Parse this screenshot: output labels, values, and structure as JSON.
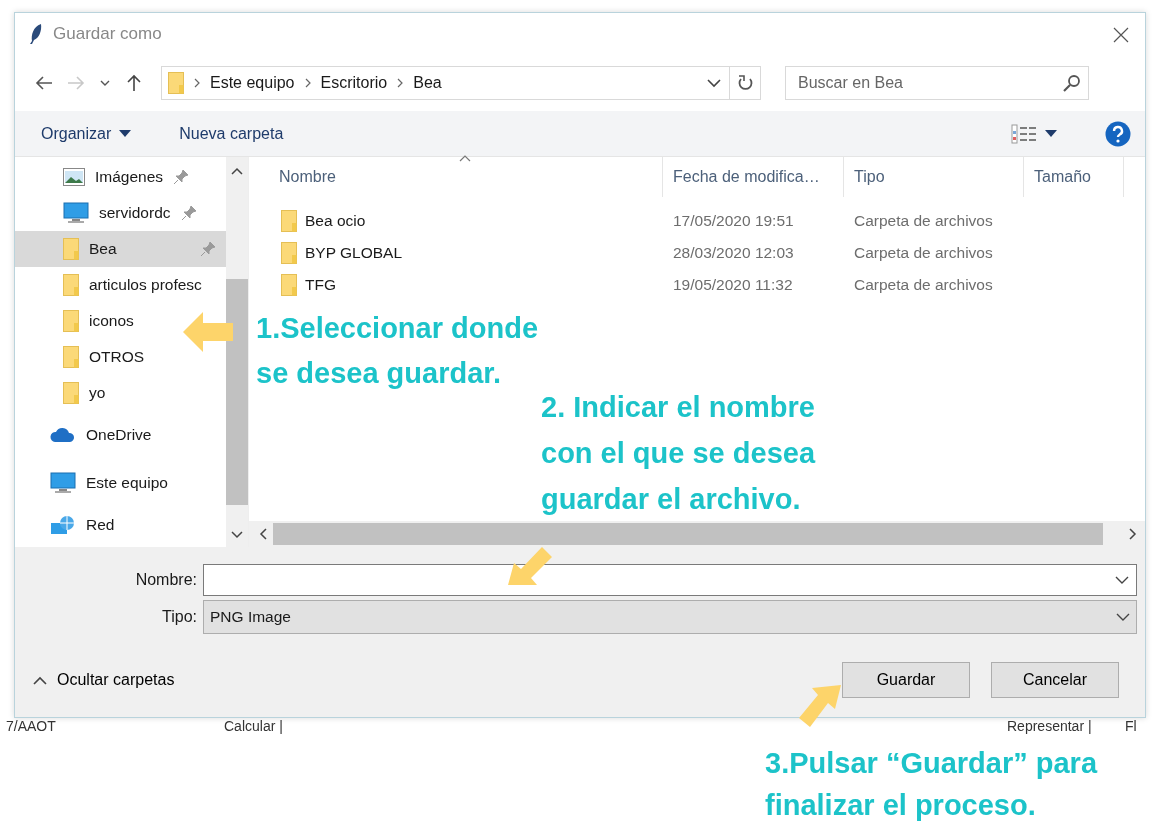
{
  "window": {
    "title": "Guardar como"
  },
  "address": {
    "path": [
      "Este equipo",
      "Escritorio",
      "Bea"
    ]
  },
  "search": {
    "placeholder": "Buscar en Bea"
  },
  "toolbar": {
    "organize": "Organizar",
    "new_folder": "Nueva carpeta"
  },
  "sidebar": {
    "quick_access": [
      {
        "label": "Imágenes",
        "kind": "pictures",
        "pinned": true,
        "selected": false
      },
      {
        "label": "servidordc",
        "kind": "computer",
        "pinned": true,
        "selected": false
      },
      {
        "label": "Bea",
        "kind": "folder",
        "pinned": true,
        "selected": true
      },
      {
        "label": "articulos profesc",
        "kind": "folder",
        "pinned": false,
        "selected": false
      },
      {
        "label": "iconos",
        "kind": "folder",
        "pinned": false,
        "selected": false
      },
      {
        "label": "OTROS",
        "kind": "folder",
        "pinned": false,
        "selected": false
      },
      {
        "label": "yo",
        "kind": "folder",
        "pinned": false,
        "selected": false
      }
    ],
    "locations": [
      {
        "label": "OneDrive",
        "kind": "cloud",
        "selected": false
      },
      {
        "label": "Este equipo",
        "kind": "computer",
        "selected": false
      },
      {
        "label": "Red",
        "kind": "network",
        "selected": false
      }
    ]
  },
  "table": {
    "columns": [
      "Nombre",
      "Fecha de modifica…",
      "Tipo",
      "Tamaño"
    ],
    "rows": [
      {
        "name": "Bea ocio",
        "date": "17/05/2020 19:51",
        "type": "Carpeta de archivos"
      },
      {
        "name": "BYP GLOBAL",
        "date": "28/03/2020 12:03",
        "type": "Carpeta de archivos"
      },
      {
        "name": "TFG",
        "date": "19/05/2020 11:32",
        "type": "Carpeta de archivos"
      }
    ]
  },
  "form": {
    "name_label": "Nombre:",
    "type_label": "Tipo:",
    "type_value": "PNG Image"
  },
  "toggle": "Ocultar carpetas",
  "buttons": [
    "Guardar",
    "Cancelar"
  ],
  "background": [
    "7/AAOT",
    "Calcular |",
    "Representar |",
    "Fl"
  ],
  "annotations": [
    "1.Seleccionar donde\nse desea guardar.",
    "2. Indicar el nombre\ncon el que se desea\nguardar el archivo.",
    "3.Pulsar “Guardar” para\nfinalizar el proceso."
  ]
}
